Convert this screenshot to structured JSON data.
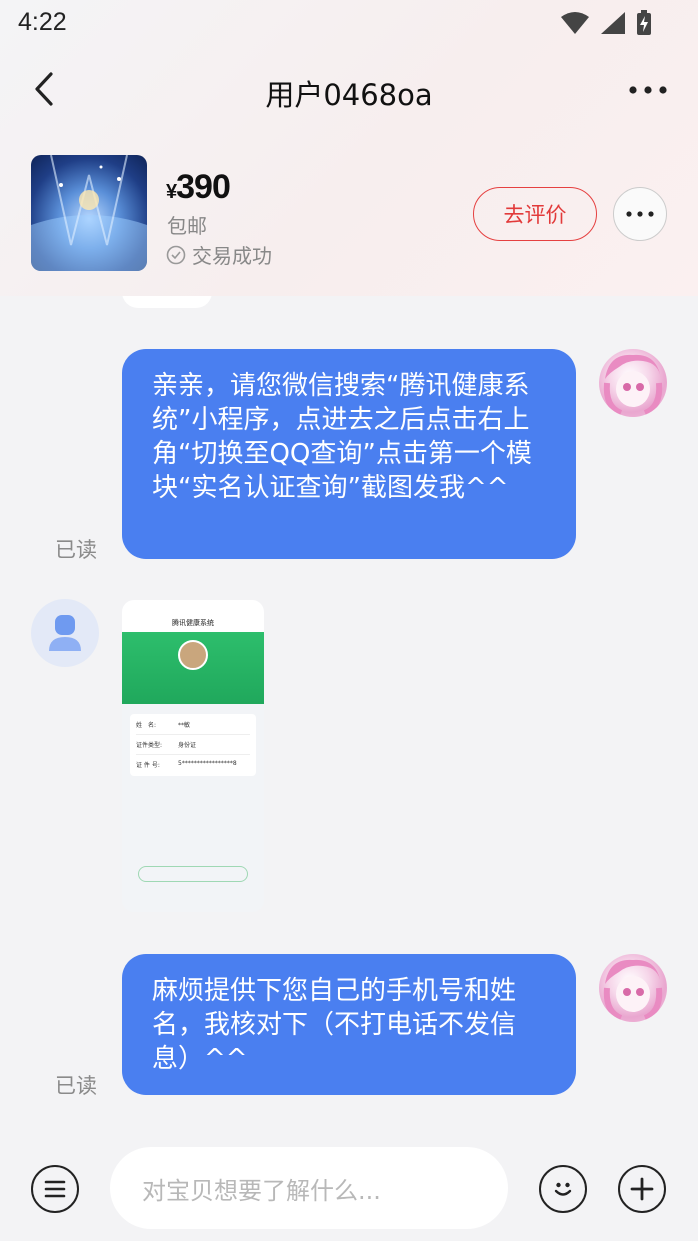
{
  "status_bar": {
    "time": "4:22"
  },
  "nav": {
    "title": "用户0468oa"
  },
  "product": {
    "currency": "¥",
    "price": "390",
    "shipping": "包邮",
    "status": "交易成功",
    "rate_button": "去评价"
  },
  "messages": [
    {
      "sender": "me",
      "text": "亲亲，请您微信搜索“腾讯健康系统”小程序，点进去之后点击右上角“切换至QQ查询”点击第一个模块“实名认证查询”截图发我^^",
      "read_status": "已读"
    },
    {
      "sender": "other",
      "type": "image",
      "image": {
        "app_title": "腾讯健康系统",
        "name_label": "姓　名:",
        "name_value": "**敏",
        "id_type_label": "证件类型:",
        "id_type_value": "身份证",
        "id_label": "证 件 号:",
        "id_value": "5*****************8"
      }
    },
    {
      "sender": "me",
      "text": "麻烦提供下您自己的手机号和姓名，我核对下（不打电话不发信息）^^",
      "read_status": "已读"
    }
  ],
  "input": {
    "placeholder": "对宝贝想要了解什么..."
  },
  "colors": {
    "bubble": "#4a7ff0",
    "accent": "#e23a3a"
  }
}
